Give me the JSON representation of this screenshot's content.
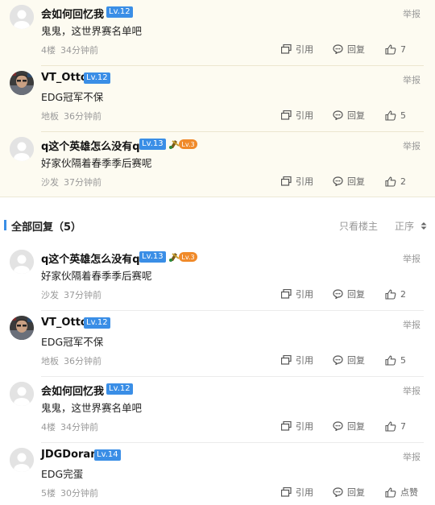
{
  "top_comments": [
    {
      "username": "会如何回忆我",
      "level": "Lv.12",
      "content": "鬼鬼，这世界赛名单吧",
      "floor": "4楼",
      "time": "34分钟前",
      "report": "举报",
      "quote": "引用",
      "reply": "回复",
      "likes": "7",
      "avatar": "default"
    },
    {
      "username": "VT_Otto",
      "level": "Lv.12",
      "content": "EDG冠军不保",
      "floor": "地板",
      "time": "36分钟前",
      "report": "举报",
      "quote": "引用",
      "reply": "回复",
      "likes": "5",
      "avatar": "photo"
    },
    {
      "username": "q这个英雄怎么没有q",
      "level": "Lv.13",
      "badge_level": "Lv.3",
      "content": "好家伙隔着春季季后赛呢",
      "floor": "沙发",
      "time": "37分钟前",
      "report": "举报",
      "quote": "引用",
      "reply": "回复",
      "likes": "2",
      "avatar": "default"
    }
  ],
  "all_replies": {
    "title": "全部回复（5）",
    "only_op": "只看楼主",
    "order": "正序",
    "accent_color": "#3a8ee6"
  },
  "replies": [
    {
      "username": "q这个英雄怎么没有q",
      "level": "Lv.13",
      "badge_level": "Lv.3",
      "content": "好家伙隔着春季季后赛呢",
      "floor": "沙发",
      "time": "37分钟前",
      "report": "举报",
      "quote": "引用",
      "reply": "回复",
      "likes": "2",
      "avatar": "default"
    },
    {
      "username": "VT_Otto",
      "level": "Lv.12",
      "content": "EDG冠军不保",
      "floor": "地板",
      "time": "36分钟前",
      "report": "举报",
      "quote": "引用",
      "reply": "回复",
      "likes": "5",
      "avatar": "photo"
    },
    {
      "username": "会如何回忆我",
      "level": "Lv.12",
      "content": "鬼鬼，这世界赛名单吧",
      "floor": "4楼",
      "time": "34分钟前",
      "report": "举报",
      "quote": "引用",
      "reply": "回复",
      "likes": "7",
      "avatar": "default"
    },
    {
      "username": "JDGDoran",
      "level": "Lv.14",
      "content": "EDG完蛋",
      "floor": "5楼",
      "time": "30分钟前",
      "report": "举报",
      "quote": "引用",
      "reply": "回复",
      "likes": "点赞",
      "avatar": "default"
    }
  ]
}
